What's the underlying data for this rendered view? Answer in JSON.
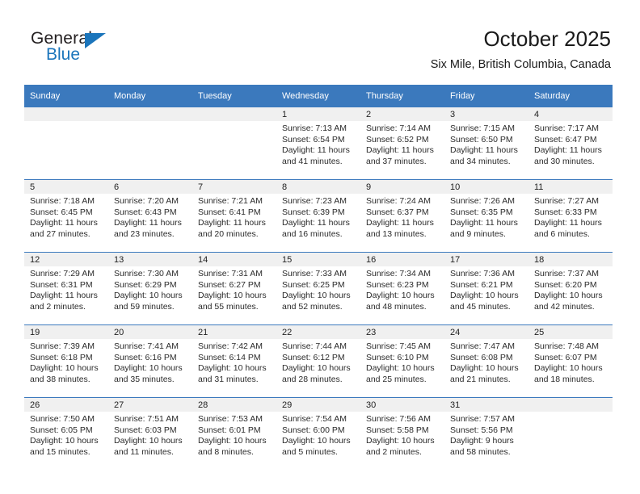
{
  "brand": {
    "name_top": "General",
    "name_bottom": "Blue",
    "accent_color": "#1b75bb"
  },
  "header": {
    "title": "October 2025",
    "subtitle": "Six Mile, British Columbia, Canada"
  },
  "theme": {
    "header_blue": "#3b79bd",
    "day_band_gray": "#f0f0f0"
  },
  "weekday_headers": [
    "Sunday",
    "Monday",
    "Tuesday",
    "Wednesday",
    "Thursday",
    "Friday",
    "Saturday"
  ],
  "labels": {
    "sunrise_prefix": "Sunrise:",
    "sunset_prefix": "Sunset:",
    "daylight_prefix": "Daylight:"
  },
  "weeks": [
    [
      {
        "empty": true
      },
      {
        "empty": true
      },
      {
        "empty": true
      },
      {
        "day": "1",
        "sunrise": "Sunrise: 7:13 AM",
        "sunset": "Sunset: 6:54 PM",
        "daylight1": "Daylight: 11 hours",
        "daylight2": "and 41 minutes."
      },
      {
        "day": "2",
        "sunrise": "Sunrise: 7:14 AM",
        "sunset": "Sunset: 6:52 PM",
        "daylight1": "Daylight: 11 hours",
        "daylight2": "and 37 minutes."
      },
      {
        "day": "3",
        "sunrise": "Sunrise: 7:15 AM",
        "sunset": "Sunset: 6:50 PM",
        "daylight1": "Daylight: 11 hours",
        "daylight2": "and 34 minutes."
      },
      {
        "day": "4",
        "sunrise": "Sunrise: 7:17 AM",
        "sunset": "Sunset: 6:47 PM",
        "daylight1": "Daylight: 11 hours",
        "daylight2": "and 30 minutes."
      }
    ],
    [
      {
        "day": "5",
        "sunrise": "Sunrise: 7:18 AM",
        "sunset": "Sunset: 6:45 PM",
        "daylight1": "Daylight: 11 hours",
        "daylight2": "and 27 minutes."
      },
      {
        "day": "6",
        "sunrise": "Sunrise: 7:20 AM",
        "sunset": "Sunset: 6:43 PM",
        "daylight1": "Daylight: 11 hours",
        "daylight2": "and 23 minutes."
      },
      {
        "day": "7",
        "sunrise": "Sunrise: 7:21 AM",
        "sunset": "Sunset: 6:41 PM",
        "daylight1": "Daylight: 11 hours",
        "daylight2": "and 20 minutes."
      },
      {
        "day": "8",
        "sunrise": "Sunrise: 7:23 AM",
        "sunset": "Sunset: 6:39 PM",
        "daylight1": "Daylight: 11 hours",
        "daylight2": "and 16 minutes."
      },
      {
        "day": "9",
        "sunrise": "Sunrise: 7:24 AM",
        "sunset": "Sunset: 6:37 PM",
        "daylight1": "Daylight: 11 hours",
        "daylight2": "and 13 minutes."
      },
      {
        "day": "10",
        "sunrise": "Sunrise: 7:26 AM",
        "sunset": "Sunset: 6:35 PM",
        "daylight1": "Daylight: 11 hours",
        "daylight2": "and 9 minutes."
      },
      {
        "day": "11",
        "sunrise": "Sunrise: 7:27 AM",
        "sunset": "Sunset: 6:33 PM",
        "daylight1": "Daylight: 11 hours",
        "daylight2": "and 6 minutes."
      }
    ],
    [
      {
        "day": "12",
        "sunrise": "Sunrise: 7:29 AM",
        "sunset": "Sunset: 6:31 PM",
        "daylight1": "Daylight: 11 hours",
        "daylight2": "and 2 minutes."
      },
      {
        "day": "13",
        "sunrise": "Sunrise: 7:30 AM",
        "sunset": "Sunset: 6:29 PM",
        "daylight1": "Daylight: 10 hours",
        "daylight2": "and 59 minutes."
      },
      {
        "day": "14",
        "sunrise": "Sunrise: 7:31 AM",
        "sunset": "Sunset: 6:27 PM",
        "daylight1": "Daylight: 10 hours",
        "daylight2": "and 55 minutes."
      },
      {
        "day": "15",
        "sunrise": "Sunrise: 7:33 AM",
        "sunset": "Sunset: 6:25 PM",
        "daylight1": "Daylight: 10 hours",
        "daylight2": "and 52 minutes."
      },
      {
        "day": "16",
        "sunrise": "Sunrise: 7:34 AM",
        "sunset": "Sunset: 6:23 PM",
        "daylight1": "Daylight: 10 hours",
        "daylight2": "and 48 minutes."
      },
      {
        "day": "17",
        "sunrise": "Sunrise: 7:36 AM",
        "sunset": "Sunset: 6:21 PM",
        "daylight1": "Daylight: 10 hours",
        "daylight2": "and 45 minutes."
      },
      {
        "day": "18",
        "sunrise": "Sunrise: 7:37 AM",
        "sunset": "Sunset: 6:20 PM",
        "daylight1": "Daylight: 10 hours",
        "daylight2": "and 42 minutes."
      }
    ],
    [
      {
        "day": "19",
        "sunrise": "Sunrise: 7:39 AM",
        "sunset": "Sunset: 6:18 PM",
        "daylight1": "Daylight: 10 hours",
        "daylight2": "and 38 minutes."
      },
      {
        "day": "20",
        "sunrise": "Sunrise: 7:41 AM",
        "sunset": "Sunset: 6:16 PM",
        "daylight1": "Daylight: 10 hours",
        "daylight2": "and 35 minutes."
      },
      {
        "day": "21",
        "sunrise": "Sunrise: 7:42 AM",
        "sunset": "Sunset: 6:14 PM",
        "daylight1": "Daylight: 10 hours",
        "daylight2": "and 31 minutes."
      },
      {
        "day": "22",
        "sunrise": "Sunrise: 7:44 AM",
        "sunset": "Sunset: 6:12 PM",
        "daylight1": "Daylight: 10 hours",
        "daylight2": "and 28 minutes."
      },
      {
        "day": "23",
        "sunrise": "Sunrise: 7:45 AM",
        "sunset": "Sunset: 6:10 PM",
        "daylight1": "Daylight: 10 hours",
        "daylight2": "and 25 minutes."
      },
      {
        "day": "24",
        "sunrise": "Sunrise: 7:47 AM",
        "sunset": "Sunset: 6:08 PM",
        "daylight1": "Daylight: 10 hours",
        "daylight2": "and 21 minutes."
      },
      {
        "day": "25",
        "sunrise": "Sunrise: 7:48 AM",
        "sunset": "Sunset: 6:07 PM",
        "daylight1": "Daylight: 10 hours",
        "daylight2": "and 18 minutes."
      }
    ],
    [
      {
        "day": "26",
        "sunrise": "Sunrise: 7:50 AM",
        "sunset": "Sunset: 6:05 PM",
        "daylight1": "Daylight: 10 hours",
        "daylight2": "and 15 minutes."
      },
      {
        "day": "27",
        "sunrise": "Sunrise: 7:51 AM",
        "sunset": "Sunset: 6:03 PM",
        "daylight1": "Daylight: 10 hours",
        "daylight2": "and 11 minutes."
      },
      {
        "day": "28",
        "sunrise": "Sunrise: 7:53 AM",
        "sunset": "Sunset: 6:01 PM",
        "daylight1": "Daylight: 10 hours",
        "daylight2": "and 8 minutes."
      },
      {
        "day": "29",
        "sunrise": "Sunrise: 7:54 AM",
        "sunset": "Sunset: 6:00 PM",
        "daylight1": "Daylight: 10 hours",
        "daylight2": "and 5 minutes."
      },
      {
        "day": "30",
        "sunrise": "Sunrise: 7:56 AM",
        "sunset": "Sunset: 5:58 PM",
        "daylight1": "Daylight: 10 hours",
        "daylight2": "and 2 minutes."
      },
      {
        "day": "31",
        "sunrise": "Sunrise: 7:57 AM",
        "sunset": "Sunset: 5:56 PM",
        "daylight1": "Daylight: 9 hours",
        "daylight2": "and 58 minutes."
      },
      {
        "empty": true
      }
    ]
  ]
}
